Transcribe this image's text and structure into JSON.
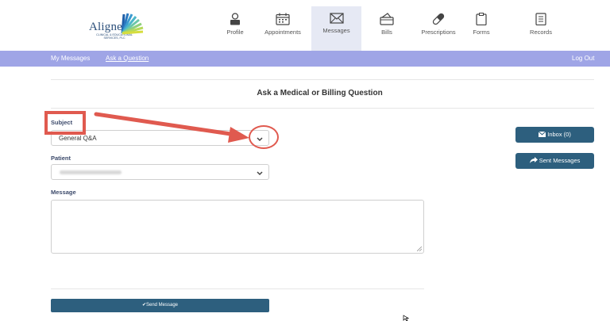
{
  "logo": {
    "brand": "Aligned",
    "subtitle": "CLINICAL & EDUCATIONAL SERVICES, PLC"
  },
  "nav": {
    "profile": "Profile",
    "appointments": "Appointments",
    "messages": "Messages",
    "bills": "Bills",
    "prescriptions": "Prescriptions",
    "forms": "Forms",
    "records": "Records"
  },
  "subnav": {
    "my_messages": "My Messages",
    "ask_question": "Ask a Question",
    "logout": "Log Out"
  },
  "page": {
    "title": "Ask a Medical or Billing Question"
  },
  "form": {
    "subject_label": "Subject",
    "subject_value": "General Q&A",
    "patient_label": "Patient",
    "message_label": "Message",
    "send_button": "✔Send Message"
  },
  "sidebar": {
    "inbox": "Inbox (0)",
    "sent": "Sent Messages"
  },
  "colors": {
    "accent": "#9fa5e6",
    "button": "#2d5f7e",
    "annotation": "#e05a4f"
  }
}
